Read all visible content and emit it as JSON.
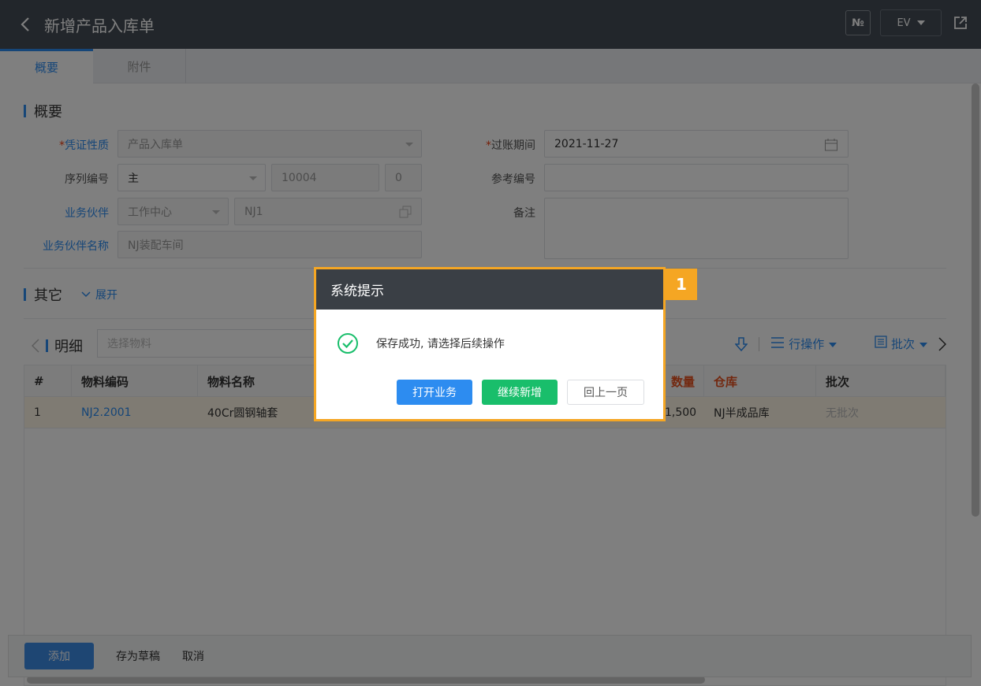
{
  "header": {
    "title": "新增产品入库单",
    "no_label": "№",
    "ev_label": "EV"
  },
  "tabs": [
    {
      "label": "概要"
    },
    {
      "label": "附件"
    }
  ],
  "overview": {
    "section_title": "概要",
    "doc_type_label": "凭证性质",
    "doc_type_value": "产品入库单",
    "serial_label": "序列编号",
    "serial_value": "主",
    "serial_number": "10004",
    "serial_suffix": "0",
    "partner_label": "业务伙伴",
    "partner_type": "工作中心",
    "partner_code": "NJ1",
    "partner_name_label": "业务伙伴名称",
    "partner_name_value": "NJ装配车间",
    "posting_period_label": "过账期间",
    "posting_period_value": "2021-11-27",
    "ref_label": "参考编号",
    "ref_value": "",
    "note_label": "备注",
    "note_value": ""
  },
  "other": {
    "section_title": "其它",
    "expand_label": "展开"
  },
  "detail": {
    "section_title": "明细",
    "search_placeholder": "选择物料",
    "row_ops_label": "行操作",
    "batch_label": "批次",
    "columns": [
      "#",
      "物料编码",
      "物料名称",
      "数量",
      "仓库",
      "批次"
    ],
    "rows": [
      {
        "idx": "1",
        "code": "NJ2.2001",
        "name": "40Cr圆钢轴套",
        "qty": "1,500",
        "warehouse": "NJ半成品库",
        "batch": "无批次"
      }
    ]
  },
  "bottom": {
    "add_label": "添加",
    "draft_label": "存为草稿",
    "cancel_label": "取消"
  },
  "dialog": {
    "title": "系统提示",
    "message": "保存成功, 请选择后续操作",
    "open_label": "打开业务",
    "continue_label": "继续新增",
    "back_label": "回上一页",
    "badge": "1"
  },
  "colors": {
    "accent": "#2d8cf0",
    "header": "#454c56",
    "highlight": "#f5a623",
    "success": "#19be6b"
  }
}
